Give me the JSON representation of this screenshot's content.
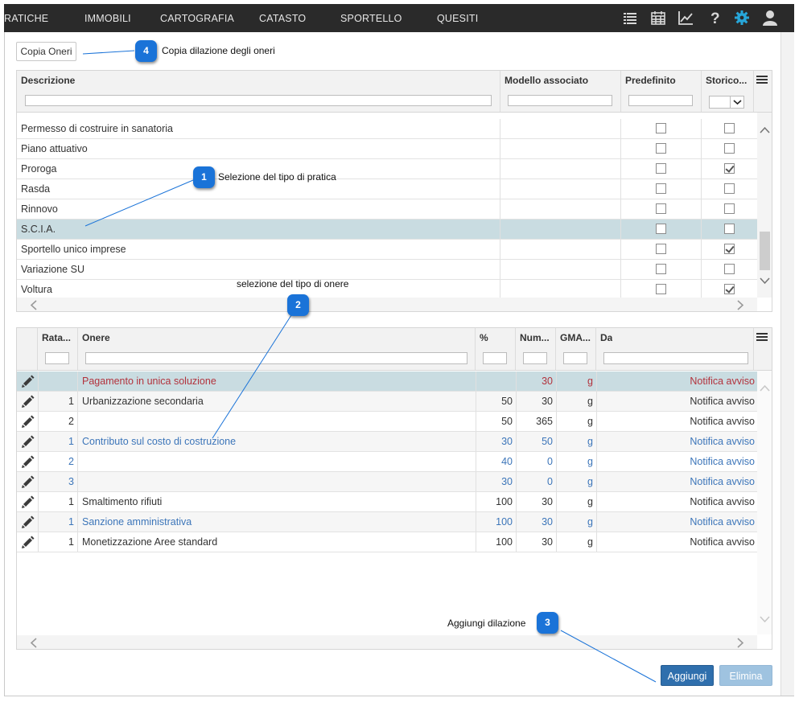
{
  "nav": {
    "items": [
      "RATICHE",
      "IMMOBILI",
      "CARTOGRAFIA",
      "CATASTO",
      "SPORTELLO",
      "QUESITI"
    ]
  },
  "toolbar": {
    "copy_label": "Copia Oneri"
  },
  "callouts": {
    "c1": {
      "num": "1",
      "text": "Selezione del tipo di pratica"
    },
    "c2": {
      "num": "2",
      "text": "selezione del tipo di onere"
    },
    "c3": {
      "num": "3",
      "text": "Aggiungi dilazione"
    },
    "c4": {
      "num": "4",
      "text": "Copia dilazione degli oneri"
    }
  },
  "types_grid": {
    "columns": [
      "Descrizione",
      "Modello associato",
      "Predefinito",
      "Storico..."
    ],
    "rows": [
      {
        "descrizione": "Permesso di costruire in sanatoria",
        "modello": "",
        "predefinito": false,
        "storico": false
      },
      {
        "descrizione": "Piano attuativo",
        "modello": "",
        "predefinito": false,
        "storico": false
      },
      {
        "descrizione": "Proroga",
        "modello": "",
        "predefinito": false,
        "storico": true
      },
      {
        "descrizione": "Rasda",
        "modello": "",
        "predefinito": false,
        "storico": false
      },
      {
        "descrizione": "Rinnovo",
        "modello": "",
        "predefinito": false,
        "storico": false
      },
      {
        "descrizione": "S.C.I.A.",
        "modello": "",
        "predefinito": false,
        "storico": false,
        "selected": true
      },
      {
        "descrizione": "Sportello unico imprese",
        "modello": "",
        "predefinito": false,
        "storico": true
      },
      {
        "descrizione": "Variazione SU",
        "modello": "",
        "predefinito": false,
        "storico": false
      },
      {
        "descrizione": "Voltura",
        "modello": "",
        "predefinito": false,
        "storico": true
      }
    ]
  },
  "oneri_grid": {
    "columns": [
      "Rata...",
      "Onere",
      "%",
      "Num...",
      "GMA...",
      "Da"
    ],
    "rows": [
      {
        "rata": "",
        "onere": "Pagamento in unica soluzione",
        "perc": "",
        "num": "30",
        "gma": "g",
        "da": "Notifica avviso",
        "style": "red",
        "selected": true
      },
      {
        "rata": "1",
        "onere": "Urbanizzazione secondaria",
        "perc": "50",
        "num": "30",
        "gma": "g",
        "da": "Notifica avviso",
        "style": "normal"
      },
      {
        "rata": "2",
        "onere": "",
        "perc": "50",
        "num": "365",
        "gma": "g",
        "da": "Notifica avviso",
        "style": "normal"
      },
      {
        "rata": "1",
        "onere": "Contributo sul costo di costruzione",
        "perc": "30",
        "num": "50",
        "gma": "g",
        "da": "Notifica avviso",
        "style": "blue"
      },
      {
        "rata": "2",
        "onere": "",
        "perc": "40",
        "num": "0",
        "gma": "g",
        "da": "Notifica avviso",
        "style": "blue"
      },
      {
        "rata": "3",
        "onere": "",
        "perc": "30",
        "num": "0",
        "gma": "g",
        "da": "Notifica avviso",
        "style": "blue"
      },
      {
        "rata": "1",
        "onere": "Smaltimento rifiuti",
        "perc": "100",
        "num": "30",
        "gma": "g",
        "da": "Notifica avviso",
        "style": "normal"
      },
      {
        "rata": "1",
        "onere": "Sanzione amministrativa",
        "perc": "100",
        "num": "30",
        "gma": "g",
        "da": "Notifica avviso",
        "style": "blue"
      },
      {
        "rata": "1",
        "onere": "Monetizzazione Aree standard",
        "perc": "100",
        "num": "30",
        "gma": "g",
        "da": "Notifica avviso",
        "style": "normal"
      }
    ]
  },
  "actions": {
    "add_label": "Aggiungi",
    "delete_label": "Elimina"
  },
  "colors": {
    "nav_bg": "#2a2a2a",
    "accent_blue": "#1a73d8",
    "selected_row": "#c9dce1",
    "link_blue": "#3c75b9",
    "warn_red": "#b2323c",
    "gear": "#27a6d9"
  }
}
